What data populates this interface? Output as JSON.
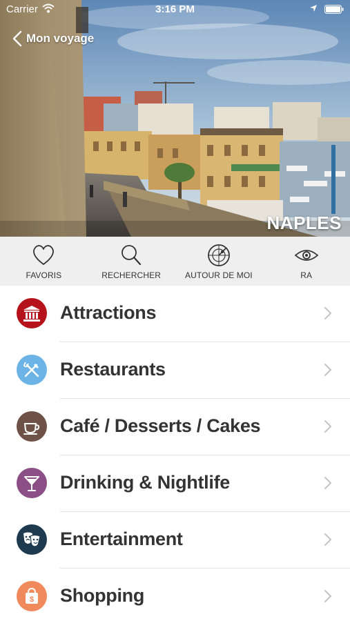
{
  "status_bar": {
    "carrier": "Carrier",
    "time": "3:16 PM"
  },
  "nav": {
    "back_label": "Mon voyage"
  },
  "hero": {
    "city": "NAPLES"
  },
  "toolbar": [
    {
      "label": "FAVORIS",
      "icon": "heart-icon"
    },
    {
      "label": "RECHERCHER",
      "icon": "search-icon"
    },
    {
      "label": "AUTOUR DE MOI",
      "icon": "radar-icon"
    },
    {
      "label": "RA",
      "icon": "eye-icon"
    }
  ],
  "categories": [
    {
      "label": "Attractions",
      "icon": "museum-icon",
      "color": "#b5121b"
    },
    {
      "label": "Restaurants",
      "icon": "fork-knife-icon",
      "color": "#6cb4e6"
    },
    {
      "label": "Café / Desserts / Cakes",
      "icon": "coffee-cup-icon",
      "color": "#6e5247"
    },
    {
      "label": "Drinking & Nightlife",
      "icon": "cocktail-icon",
      "color": "#8c4f85"
    },
    {
      "label": "Entertainment",
      "icon": "theater-masks-icon",
      "color": "#1f3a4f"
    },
    {
      "label": "Shopping",
      "icon": "shopping-bag-icon",
      "color": "#f08a5d"
    }
  ]
}
